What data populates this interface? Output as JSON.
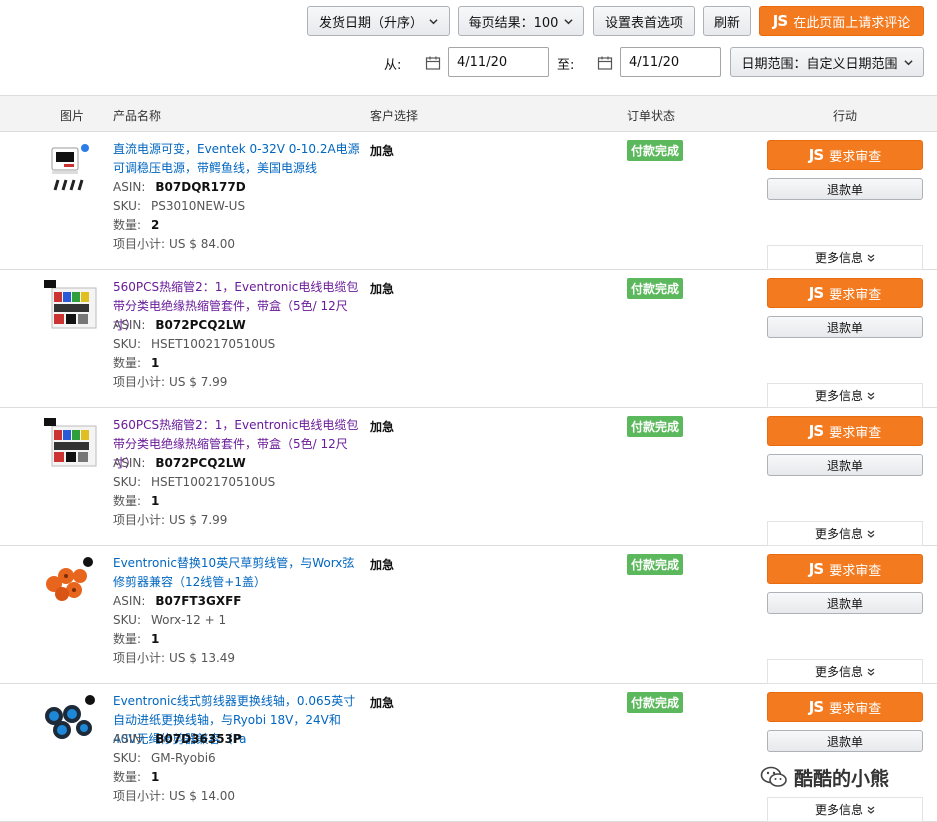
{
  "toolbar": {
    "sort_label": "发货日期（升序）",
    "per_page_label": "每页结果：100",
    "settings_label": "设置表首选项",
    "refresh_label": "刷新",
    "request_review_label": "在此页面上请求评论",
    "from_label": "从:",
    "from_date": "4/11/20",
    "to_label": "至:",
    "to_date": "4/11/20",
    "range_label": "日期范围：自定义日期范围"
  },
  "columns": [
    "图片",
    "产品名称",
    "客户选择",
    "订单状态",
    "行动"
  ],
  "labels": {
    "asin": "ASIN:",
    "sku": "SKU:",
    "qty": "数量:",
    "subtotal": "项目小计:",
    "review_button": "要求审查",
    "refund_button": "退款单",
    "more_info": "更多信息",
    "js_logo": "JS"
  },
  "orders": [
    {
      "title": "直流电源可变，Eventek 0-32V 0-10.2A电源可调稳压电源，带鳄鱼线，美国电源线",
      "asin": "B07DQR177D",
      "sku": "PS3010NEW-US",
      "qty": "2",
      "subtotal": "US $ 84.00",
      "customer": "加急",
      "status": "付款完成",
      "visited": false,
      "icon": "power-supply-icon"
    },
    {
      "title": "560PCS热缩管2：1，Eventronic电线电缆包带分类电绝缘热缩管套件，带盒（5色/ 12尺寸）",
      "asin": "B072PCQ2LW",
      "sku": "HSET1002170510US",
      "qty": "1",
      "subtotal": "US $ 7.99",
      "customer": "加急",
      "status": "付款完成",
      "visited": true,
      "icon": "heat-shrink-kit-icon"
    },
    {
      "title": "560PCS热缩管2：1，Eventronic电线电缆包带分类电绝缘热缩管套件，带盒（5色/ 12尺寸）",
      "asin": "B072PCQ2LW",
      "sku": "HSET1002170510US",
      "qty": "1",
      "subtotal": "US $ 7.99",
      "customer": "加急",
      "status": "付款完成",
      "visited": true,
      "icon": "heat-shrink-kit-icon"
    },
    {
      "title": "Eventronic替换10英尺草剪线管，与Worx弦修剪器兼容（12线管+1盖）",
      "asin": "B07FT3GXFF",
      "sku": "Worx-12 + 1",
      "qty": "1",
      "subtotal": "US $ 13.49",
      "customer": "加急",
      "status": "付款完成",
      "visited": false,
      "icon": "orange-spools-icon"
    },
    {
      "title": "Eventronic线式剪线器更换线轴，0.065英寸自动进纸更换线轴，与Ryobi 18V，24V和40V无绳修剪器兼容（Pa",
      "asin": "B07D36353P",
      "sku": "GM-Ryobi6",
      "qty": "1",
      "subtotal": "US $ 14.00",
      "customer": "加急",
      "status": "付款完成",
      "visited": false,
      "icon": "blue-spools-icon"
    }
  ],
  "watermark": "酷酷的小熊",
  "colors": {
    "accent_orange": "#f47a1f",
    "status_green": "#5cb85c",
    "link_blue": "#0066c0",
    "visited_purple": "#6a1b9a"
  }
}
